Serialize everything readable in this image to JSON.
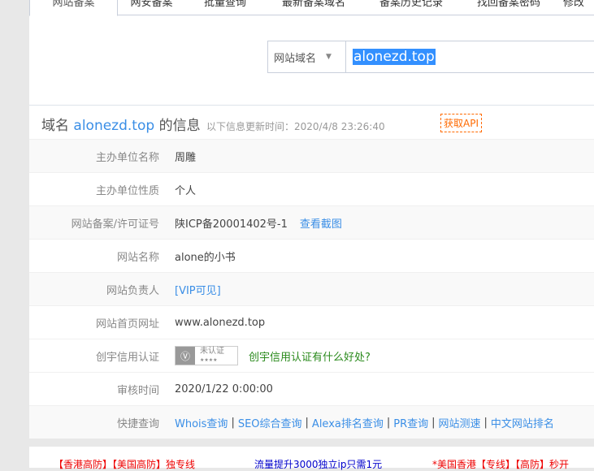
{
  "tabs": [
    "网站备案",
    "网安备案",
    "批量查询",
    "最新备案域名",
    "备案历史记录",
    "找回备案密码",
    "修改"
  ],
  "search": {
    "type": "网站域名",
    "value": "alonezd.top"
  },
  "header": {
    "prefix": "域名",
    "domain": "alonezd.top",
    "suffix": "的信息",
    "updated": "以下信息更新时间：2020/4/8 23:26:40",
    "api": "获取API"
  },
  "rows": [
    {
      "label": "主办单位名称",
      "value": "周雕"
    },
    {
      "label": "主办单位性质",
      "value": "个人"
    },
    {
      "label": "网站备案/许可证号",
      "value": "陕ICP备20001402号-1",
      "link": "查看截图"
    },
    {
      "label": "网站名称",
      "value": "alone的小书"
    },
    {
      "label": "网站负责人",
      "link": "[VIP可见]"
    },
    {
      "label": "网站首页网址",
      "value": "www.alonezd.top"
    },
    {
      "label": "创宇信用认证",
      "badge": "未认证",
      "badge_stars": "★★★★",
      "link": "创宇信用认证有什么好处?"
    },
    {
      "label": "审核时间",
      "value": "2020/1/22 0:00:00"
    },
    {
      "label": "快捷查询",
      "links": [
        "Whois查询",
        "SEO综合查询",
        "Alexa排名查询",
        "PR查询",
        "网站测速",
        "中文网站排名"
      ]
    }
  ],
  "ads": [
    "【香港高防】【美国高防】独专线",
    "流量提升3000独立ip只需1元",
    "*美国香港【专线】【高防】秒开"
  ]
}
